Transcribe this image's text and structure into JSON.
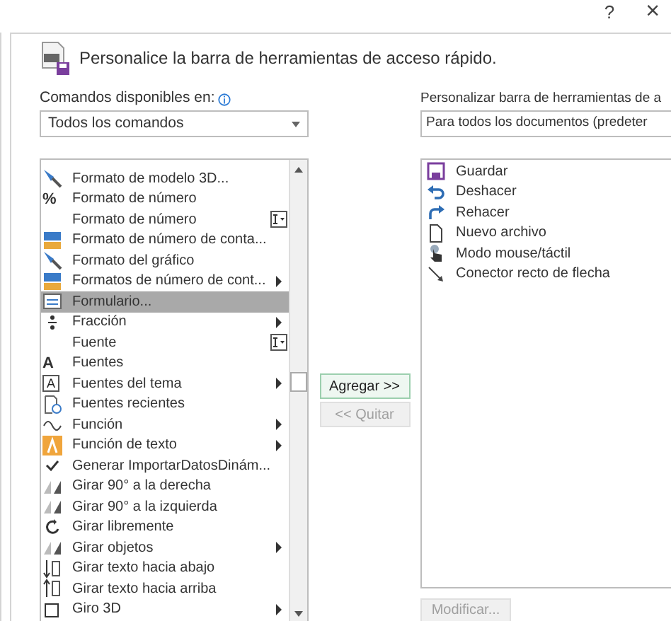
{
  "title_bar": {
    "help": "?",
    "close": "×"
  },
  "header": {
    "title": "Personalice la barra de herramientas de acceso rápido."
  },
  "commands_label": "Comandos disponibles en:",
  "commands_dropdown": {
    "value": "Todos los comandos"
  },
  "customize_label": "Personalizar barra de herramientas de a",
  "customize_dropdown": {
    "value": "Para todos los documentos (predeter"
  },
  "commands": [
    {
      "label": "Formato de modelo 3D...",
      "kind": "brush",
      "selected": false
    },
    {
      "label": "Formato de número",
      "kind": "glyph",
      "glyph": "%",
      "selected": false
    },
    {
      "label": "Formato de número",
      "kind": "blank",
      "text_field": true,
      "selected": false
    },
    {
      "label": "Formato de número de conta...",
      "kind": "numfmt",
      "selected": false
    },
    {
      "label": "Formato del gráfico",
      "kind": "brush",
      "selected": false
    },
    {
      "label": "Formatos de número de cont...",
      "kind": "numfmt",
      "submenu": true,
      "selected": false
    },
    {
      "label": "Formulario...",
      "kind": "form",
      "selected": true
    },
    {
      "label": "Fracción",
      "kind": "fraction",
      "submenu": true,
      "selected": false
    },
    {
      "label": "Fuente",
      "kind": "blank",
      "text_field": true,
      "selected": false
    },
    {
      "label": "Fuentes",
      "kind": "glyph",
      "glyph": "A",
      "selected": false
    },
    {
      "label": "Fuentes del tema",
      "kind": "boxglyph",
      "glyph": "A",
      "submenu": true,
      "selected": false
    },
    {
      "label": "Fuentes recientes",
      "kind": "clock",
      "selected": false
    },
    {
      "label": "Función",
      "kind": "sin",
      "submenu": true,
      "selected": false
    },
    {
      "label": "Función de texto",
      "kind": "textfunc",
      "submenu": true,
      "selected": false
    },
    {
      "label": "Generar ImportarDatosDinám...",
      "kind": "check",
      "selected": false
    },
    {
      "label": "Girar 90° a la derecha",
      "kind": "rotate",
      "selected": false
    },
    {
      "label": "Girar 90° a la izquierda",
      "kind": "rotate",
      "selected": false
    },
    {
      "label": "Girar libremente",
      "kind": "circular",
      "selected": false
    },
    {
      "label": "Girar objetos",
      "kind": "rotate",
      "submenu": true,
      "selected": false
    },
    {
      "label": "Girar texto hacia abajo",
      "kind": "textdown",
      "selected": false
    },
    {
      "label": "Girar texto hacia arriba",
      "kind": "textup",
      "selected": false
    },
    {
      "label": "Giro 3D",
      "kind": "cube",
      "submenu": true,
      "selected": false
    }
  ],
  "add_button": {
    "label": "Agregar >>",
    "disabled": false
  },
  "remove_button": {
    "label": "<< Quitar",
    "disabled": true
  },
  "toolbar_items": [
    {
      "label": "Guardar",
      "kind": "save"
    },
    {
      "label": "Deshacer",
      "kind": "undo"
    },
    {
      "label": "Rehacer",
      "kind": "redo"
    },
    {
      "label": "Nuevo archivo",
      "kind": "file"
    },
    {
      "label": "Modo mouse/táctil",
      "kind": "touch"
    },
    {
      "label": "Conector recto de flecha",
      "kind": "arrow"
    }
  ],
  "modify_button": {
    "label": "Modificar...",
    "disabled": true
  }
}
